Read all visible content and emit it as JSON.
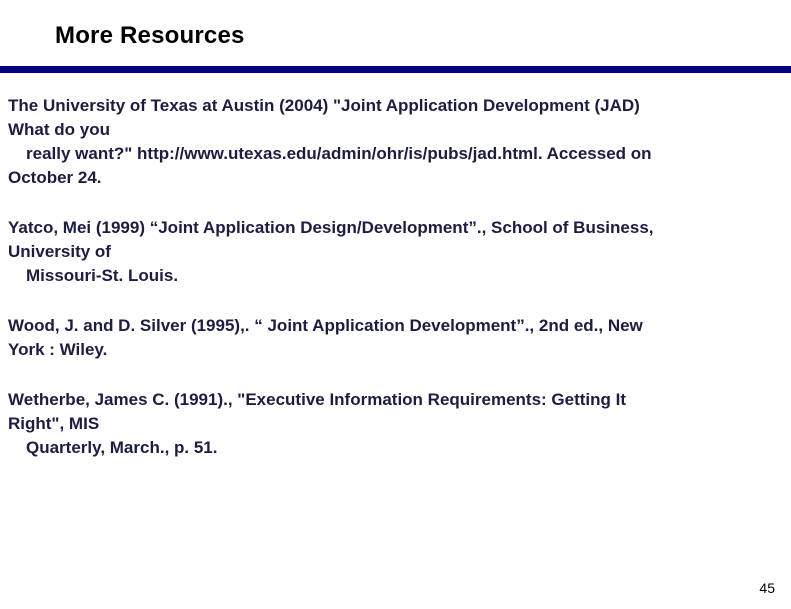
{
  "slide": {
    "title": "More Resources",
    "page_number": "45",
    "accent_color": "#000080"
  },
  "references": [
    {
      "lines": [
        "The University of Texas at Austin (2004) \"Joint Application Development (JAD)",
        "What do you",
        "really want?\" http://www.utexas.edu/admin/ohr/is/pubs/jad.html.  Accessed on",
        "October 24."
      ]
    },
    {
      "lines": [
        "Yatco, Mei (1999) “Joint Application Design/Development”., School of Business,",
        "University of",
        "Missouri-St. Louis."
      ]
    },
    {
      "lines": [
        "Wood, J. and D. Silver (1995),. “ Joint Application Development”., 2nd ed., New",
        "York : Wiley."
      ]
    },
    {
      "lines": [
        "Wetherbe, James C. (1991)., \"Executive Information Requirements: Getting It",
        "Right\", MIS",
        "Quarterly,  March.,  p. 51."
      ]
    }
  ]
}
